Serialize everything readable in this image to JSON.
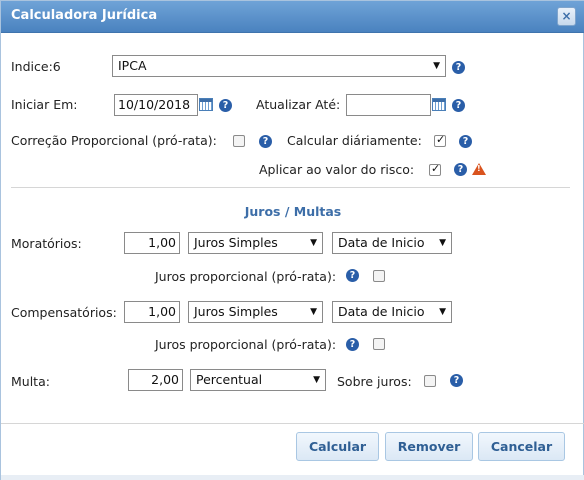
{
  "dialog": {
    "title": "Calculadora Jurídica",
    "close_label": "×"
  },
  "indice": {
    "label": "Indice:6",
    "selected": "IPCA"
  },
  "iniciar": {
    "label": "Iniciar Em:",
    "value": "10/10/2018"
  },
  "atualizar": {
    "label": "Atualizar Até:",
    "value": ""
  },
  "correcao": {
    "label": "Correção Proporcional (pró-rata):",
    "checked": false
  },
  "calcular_diariamente": {
    "label": "Calcular diáriamente:",
    "checked": true
  },
  "aplicar_risco": {
    "label": "Aplicar ao valor do risco:",
    "checked": true
  },
  "section": {
    "title": "Juros / Multas"
  },
  "moratorios": {
    "label": "Moratórios:",
    "value": "1,00",
    "tipo": "Juros Simples",
    "data": "Data de Inicio",
    "prorata_label": "Juros proporcional (pró-rata):",
    "prorata_checked": false
  },
  "compensatorios": {
    "label": "Compensatórios:",
    "value": "1,00",
    "tipo": "Juros Simples",
    "data": "Data de Inicio",
    "prorata_label": "Juros proporcional (pró-rata):",
    "prorata_checked": false
  },
  "multa": {
    "label": "Multa:",
    "value": "2,00",
    "tipo": "Percentual",
    "sobre_juros_label": "Sobre juros:",
    "sobre_juros_checked": false
  },
  "buttons": {
    "calcular": "Calcular",
    "remover": "Remover",
    "cancelar": "Cancelar"
  },
  "icons": {
    "help": "?",
    "warning": "!",
    "dropdown": "▼"
  },
  "colors": {
    "titlebar": "#4a82bf",
    "accent": "#3d6ea8",
    "help_icon": "#2a5ea8",
    "warning_icon": "#d9531e"
  }
}
